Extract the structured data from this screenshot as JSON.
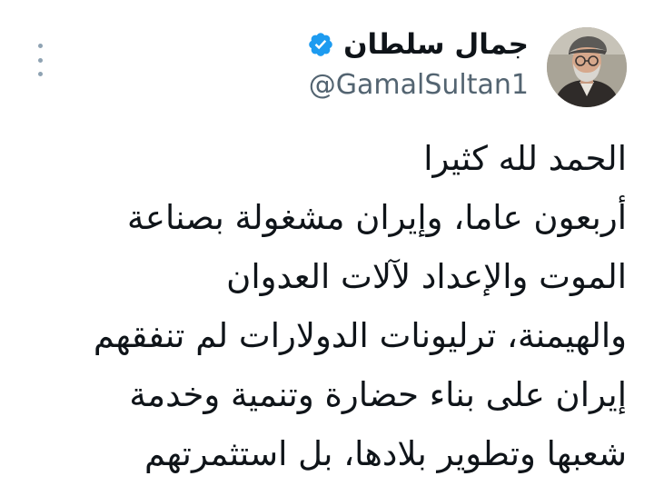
{
  "author": {
    "display_name": "جمال سلطان",
    "handle": "@GamalSultan1",
    "verified": true
  },
  "icons": {
    "verified": "verified-badge-icon",
    "more": "more-vertical-icon"
  },
  "colors": {
    "verified_badge": "#1d9bf0",
    "handle_text": "#536471",
    "body_text": "#0f1419"
  },
  "tweet": {
    "lines": [
      "الحمد لله كثيرا",
      "أربعون عاما، وإيران مشغولة بصناعة",
      "الموت والإعداد لآلات العدوان",
      "والهيمنة، ترليونات الدولارات لم تنفقهم",
      "إيران على بناء حضارة وتنمية وخدمة",
      "شعبها وتطوير بلادها، بل استثمرتهم"
    ]
  }
}
